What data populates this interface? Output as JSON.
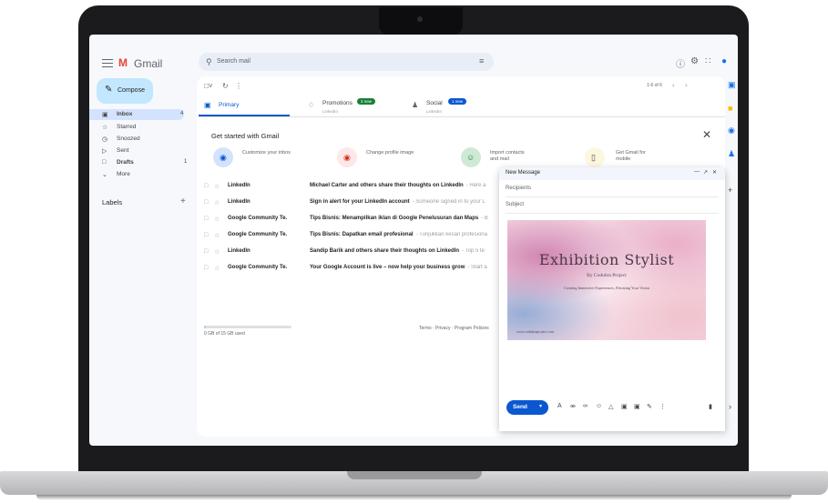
{
  "header": {
    "app_name": "Gmail",
    "search_placeholder": "Search mail",
    "icons": [
      "help-icon",
      "settings-icon",
      "apps-grid-icon",
      "account-icon"
    ]
  },
  "sidebar": {
    "compose_label": "Compose",
    "items": [
      {
        "label": "Inbox",
        "icon": "inbox-icon",
        "count": "4",
        "active": true
      },
      {
        "label": "Starred",
        "icon": "star-icon",
        "count": ""
      },
      {
        "label": "Snoozed",
        "icon": "clock-icon",
        "count": ""
      },
      {
        "label": "Sent",
        "icon": "send-icon",
        "count": ""
      },
      {
        "label": "Drafts",
        "icon": "draft-icon",
        "count": "1"
      },
      {
        "label": "More",
        "icon": "chevron-down-icon",
        "count": ""
      }
    ],
    "labels_title": "Labels"
  },
  "toolbar": {
    "pager_text": "1-6 of 6"
  },
  "tabs": [
    {
      "label": "Primary",
      "sub": "",
      "badge": "",
      "badge_color": ""
    },
    {
      "label": "Promotions",
      "sub": "LinkedIn",
      "badge": "2 new",
      "badge_color": "#188038"
    },
    {
      "label": "Social",
      "sub": "LinkedIn",
      "badge": "1 new",
      "badge_color": "#0b57d0"
    }
  ],
  "getting_started": {
    "title": "Get started with Gmail",
    "cards": [
      {
        "label": "Customize your inbox",
        "icon": "customize-icon",
        "color": "#d3e3fd",
        "glyph_color": "#0b57d0"
      },
      {
        "label": "Change profile image",
        "icon": "profile-image-icon",
        "color": "#fce8e6",
        "glyph_color": "#d93025"
      },
      {
        "label": "Import contacts and mail",
        "icon": "import-contacts-icon",
        "color": "#ceead6",
        "glyph_color": "#188038"
      },
      {
        "label": "Get Gmail for mobile",
        "icon": "mobile-icon",
        "color": "#fef7e0",
        "glyph_color": "#444444"
      }
    ]
  },
  "emails": [
    {
      "sender": "LinkedIn",
      "subject": "Michael Carter and others share their thoughts on LinkedIn",
      "snippet": "- Here a"
    },
    {
      "sender": "LinkedIn",
      "subject": "Sign in alert for your LinkedIn account",
      "snippet": "- Someone signed in to your L"
    },
    {
      "sender": "Google Community Te.",
      "subject": "Tips Bisnis: Menampilkan iklan di Google Penelusuran dan Maps",
      "snippet": "- B"
    },
    {
      "sender": "Google Community Te.",
      "subject": "Tips Bisnis: Dapatkan email profesional",
      "snippet": "- Tunjukkan kesan profesiona"
    },
    {
      "sender": "LinkedIn",
      "subject": "Sandip Barik and others share their thoughts on LinkedIn",
      "snippet": "- Top 5 te"
    },
    {
      "sender": "Google Community Te.",
      "subject": "Your Google Account is live – now help your business grow",
      "snippet": "- Start a"
    }
  ],
  "footer": {
    "storage_text": "0 GB of 15 GB used",
    "storage_fraction": 0.02,
    "links": "Terms · Privacy · Program Policies"
  },
  "compose_window": {
    "title": "New Message",
    "recipients_placeholder": "Recipients",
    "subject_placeholder": "Subject",
    "send_label": "Send",
    "poster": {
      "title": "Exhibition Stylist",
      "byline": "By Codubra Project",
      "tagline": "Creating Immersive Experiences, Elevating Your Vision",
      "url": "www.codubraproject.com"
    }
  }
}
